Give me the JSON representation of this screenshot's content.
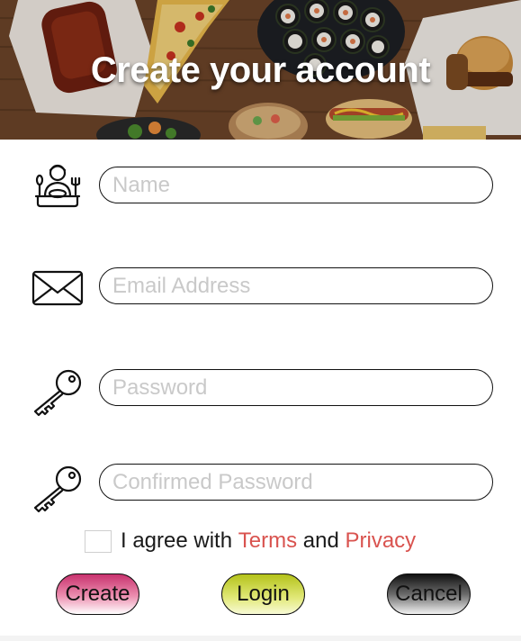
{
  "header": {
    "title": "Create your account",
    "background": "food-photo"
  },
  "form": {
    "fields": [
      {
        "name": "name",
        "placeholder": "Name",
        "value": "",
        "icon": "chef-icon"
      },
      {
        "name": "email",
        "placeholder": "Email Address",
        "value": "",
        "icon": "envelope-icon"
      },
      {
        "name": "password",
        "placeholder": "Password",
        "value": "",
        "icon": "key-icon"
      },
      {
        "name": "confirm_password",
        "placeholder": "Confirmed Password",
        "value": "",
        "icon": "key-icon"
      }
    ]
  },
  "agreement": {
    "checked": false,
    "prefix": "I agree with",
    "terms_label": "Terms",
    "conjunction": "and",
    "privacy_label": "Privacy",
    "link_color": "#d9534f"
  },
  "buttons": {
    "create_label": "Create",
    "login_label": "Login",
    "cancel_label": "Cancel",
    "create_color": "#c8326e",
    "login_color": "#b4c21a",
    "cancel_color": "#111111"
  }
}
